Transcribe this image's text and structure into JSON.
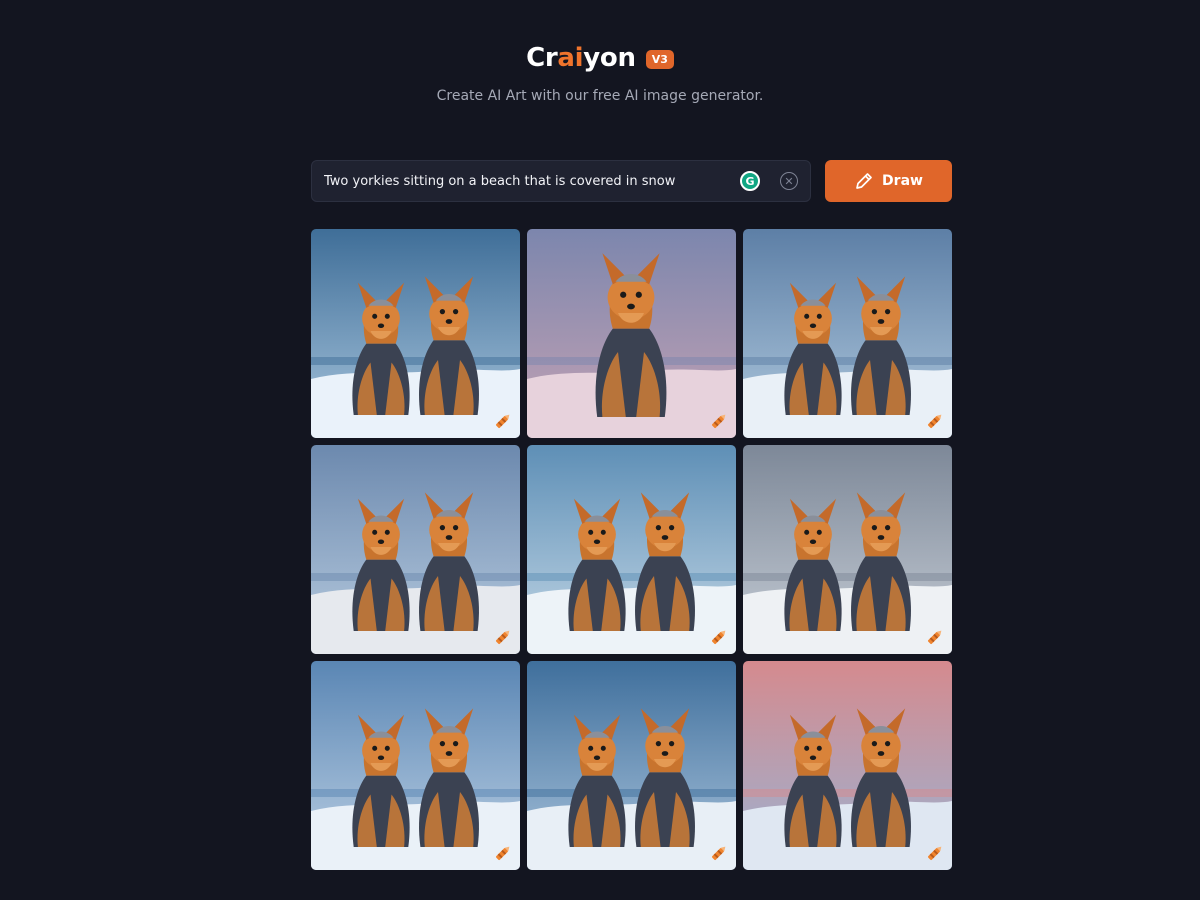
{
  "header": {
    "logo_before": "Cr",
    "logo_accent": "ai",
    "logo_after": "yon",
    "version": "V3",
    "subtitle": "Create AI Art with our free AI image generator."
  },
  "prompt": {
    "value": "Two yorkies sitting on a beach that is covered in snow",
    "grammarly_icon": "grammarly-icon",
    "clear_icon": "clear-circle-x-icon"
  },
  "draw_button": {
    "label": "Draw",
    "icon": "pencil-icon"
  },
  "colors": {
    "background": "#131520",
    "accent": "#e0662a",
    "input_bg": "#1f2230"
  },
  "results": [
    {
      "sky_top": "#3f6e98",
      "sky_bottom": "#a9c6de",
      "ground": "#eaf2fa",
      "dogs": 2
    },
    {
      "sky_top": "#7c86ad",
      "sky_bottom": "#c4a2b4",
      "ground": "#e7d2dc",
      "dogs": 1
    },
    {
      "sky_top": "#5d7fa6",
      "sky_bottom": "#b0c9de",
      "ground": "#e9f0f7",
      "dogs": 2
    },
    {
      "sky_top": "#6c89ae",
      "sky_bottom": "#b8cce0",
      "ground": "#e6e9ee",
      "dogs": 2
    },
    {
      "sky_top": "#5e8fb6",
      "sky_bottom": "#c3d7e6",
      "ground": "#edf3f8",
      "dogs": 2
    },
    {
      "sky_top": "#7d8898",
      "sky_bottom": "#c6cdd6",
      "ground": "#eef1f4",
      "dogs": 2
    },
    {
      "sky_top": "#5a86b4",
      "sky_bottom": "#bcd0e4",
      "ground": "#eaf1f8",
      "dogs": 2
    },
    {
      "sky_top": "#3f6f9c",
      "sky_bottom": "#a9c3dc",
      "ground": "#e8eff6",
      "dogs": 2
    },
    {
      "sky_top": "#d58a8e",
      "sky_bottom": "#9bb3d3",
      "ground": "#dfe7f2",
      "dogs": 2
    }
  ]
}
